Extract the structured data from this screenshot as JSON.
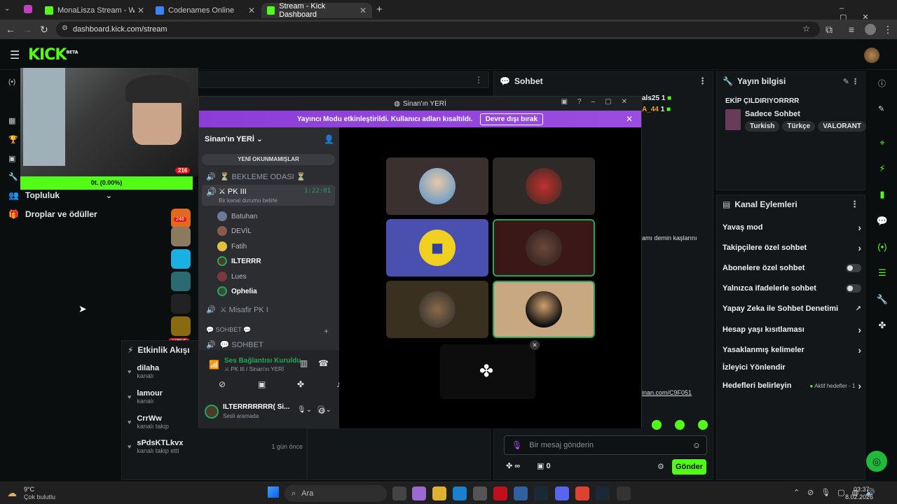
{
  "browser": {
    "tabs": [
      {
        "label": "MonaLisza Stream - Watch Live",
        "active": false,
        "color": "#53fc18"
      },
      {
        "label": "Codenames Online",
        "active": false,
        "color": "#3b82f6"
      },
      {
        "label": "Stream - Kick Dashboard",
        "active": true,
        "color": "#53fc18"
      }
    ],
    "url": "dashboard.kick.com/stream"
  },
  "kick": {
    "logo": "KICK",
    "logo_badge": "BETA",
    "nav": [
      {
        "label": "Topluluk",
        "icon": "users-icon"
      },
      {
        "label": "Droplar ve ödüller",
        "icon": "gift-icon"
      }
    ],
    "cam_overlay_progress": "0t. (0.00%)",
    "panels": {
      "chat_title": "Sohbet",
      "chat_link": "inan.com/C9F051",
      "chat_snippet": "amı demin kaşlarını",
      "chat_users": [
        {
          "name": "als25",
          "count": "1"
        },
        {
          "name": "A_44",
          "count": "1"
        }
      ],
      "chat_input_placeholder": "Bir mesaj gönderin",
      "send_label": "Gönder",
      "bottom_counts": {
        "infinite": "∞",
        "zero": "0"
      },
      "stream_info_title": "Yayın bilgisi",
      "stream_title": "EKİP ÇILDIRIYORRRR",
      "category": "Sadece Sohbet",
      "tags": [
        "Turkish",
        "Türkçe",
        "VALORANT"
      ],
      "channel_actions_title": "Kanal Eylemleri",
      "actions": [
        {
          "label": "Yavaş mod",
          "type": "chevron"
        },
        {
          "label": "Takipçilere özel sohbet",
          "type": "chevron"
        },
        {
          "label": "Abonelere özel sohbet",
          "type": "toggle"
        },
        {
          "label": "Yalnızca ifadelerle sohbet",
          "type": "toggle"
        },
        {
          "label": "Yapay Zeka ile Sohbet Denetimi",
          "type": "external"
        },
        {
          "label": "Hesap yaşı kısıtlaması",
          "type": "chevron"
        },
        {
          "label": "Yasaklanmış kelimeler",
          "type": "chevron"
        },
        {
          "label": "İzleyici Yönlendir",
          "type": "none"
        },
        {
          "label": "Hedefleri belirleyin",
          "type": "goal"
        }
      ],
      "goal_status": "Aktif hedefler - 1",
      "activity_title": "Etkinlik Akışı",
      "activity": [
        {
          "user": "dilaha",
          "text": "kanalı"
        },
        {
          "user": "lamour",
          "text": "kanalı"
        },
        {
          "user": "CrrWw",
          "text": "kanalı takip"
        },
        {
          "user": "sPdsKTLkvx",
          "text": "kanalı takip etti",
          "time": "1 gün önce"
        }
      ],
      "badges": {
        "red": "216",
        "count1": "248",
        "new": "YENİ"
      }
    }
  },
  "discord": {
    "window_title": "Sinan'ın YERİ",
    "banner_text": "Yayıncı Modu etkinleştirildi. Kullanıcı adları kısaltıldı.",
    "banner_button": "Devre dışı bırak",
    "server_name": "Sinan'ın YERİ",
    "unread_label": "YENİ OKUNMAMIŞLAR",
    "channels": {
      "waiting": "⏳ BEKLEME ODASI ⏳",
      "pk3": "⚔ PK III",
      "pk3_time": "1:22:01",
      "pk3_status": "Bir kanal durumu belirle",
      "guest": "⚔ Misafir PK I",
      "chat_cat": "💬 SOHBET 💬",
      "chat": "💬 SOHBET"
    },
    "users": [
      {
        "name": "Batuhan",
        "active": false
      },
      {
        "name": "DEVİL",
        "active": false
      },
      {
        "name": "Fatih",
        "active": false
      },
      {
        "name": "ILTERRR",
        "active": true
      },
      {
        "name": "Lues",
        "active": false
      },
      {
        "name": "Ophelia",
        "active": true
      }
    ],
    "voice_status": "Ses Bağlantısı Kuruldu",
    "voice_sub": "⚔ PK III / Sinan'ın YERİ",
    "me_name": "ILTERRRRRRR( Si...",
    "me_status": "Sesli aramada"
  },
  "taskbar": {
    "weather_temp": "9°C",
    "weather_desc": "Çok bulutlu",
    "search": "Ara",
    "time": "03:37",
    "date": "8.02.2026"
  }
}
